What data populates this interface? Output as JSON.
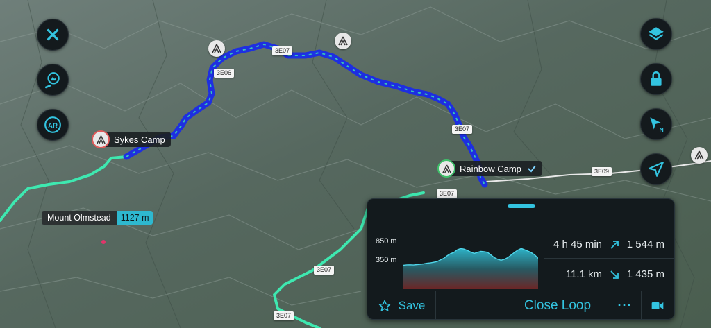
{
  "map": {
    "route_labels": [
      "3E07",
      "3E06",
      "3E07",
      "3E07",
      "3E09",
      "3E07",
      "3E07"
    ],
    "camps": [
      {
        "name": "Sykes Camp",
        "ring_color": "#e05a5a"
      },
      {
        "name": "Rainbow Camp",
        "ring_color": "#3fbf6a"
      }
    ],
    "peak": {
      "name": "Mount Olmstead",
      "elevation": "1127 m"
    },
    "colors": {
      "planned_route": "#1a2be8",
      "trail_highlight": "#3ee8b0",
      "road": "#e8e8e8"
    }
  },
  "buttons_left": [
    {
      "name": "close",
      "icon": "x-icon"
    },
    {
      "name": "search-peak",
      "icon": "search-peak-icon"
    },
    {
      "name": "ar",
      "icon": "ar-icon",
      "label": "AR"
    }
  ],
  "buttons_right": [
    {
      "name": "layers",
      "icon": "layers-icon"
    },
    {
      "name": "lock",
      "icon": "lock-icon"
    },
    {
      "name": "compass",
      "icon": "compass-north-icon",
      "label": "N"
    },
    {
      "name": "locate",
      "icon": "location-arrow-icon"
    }
  ],
  "panel": {
    "elevation_max": "850 m",
    "elevation_min": "350 m",
    "duration": "4 h 45 min",
    "distance": "11.1 km",
    "ascent": "1 544 m",
    "descent": "1 435 m",
    "save_label": "Save",
    "close_loop_label": "Close Loop",
    "more_label": "···",
    "accent": "#33c4e0"
  },
  "chart_data": {
    "type": "area",
    "x": [
      0,
      1,
      2,
      3,
      4,
      5,
      6,
      7,
      8,
      9,
      10,
      11,
      12,
      13,
      14,
      15,
      16,
      17,
      18,
      19,
      20,
      21,
      22,
      23,
      24,
      25,
      26,
      27,
      28,
      29,
      30,
      31,
      32,
      33,
      34,
      35,
      36,
      37,
      38,
      39,
      40
    ],
    "values": [
      365,
      370,
      372,
      368,
      375,
      380,
      385,
      395,
      400,
      410,
      420,
      445,
      470,
      510,
      540,
      560,
      600,
      620,
      610,
      590,
      565,
      545,
      560,
      575,
      570,
      560,
      520,
      480,
      455,
      440,
      455,
      480,
      520,
      560,
      595,
      620,
      600,
      580,
      555,
      520,
      470
    ],
    "ylim": [
      0,
      950
    ],
    "y_tick_labels": [
      "350 m",
      "850 m"
    ]
  }
}
